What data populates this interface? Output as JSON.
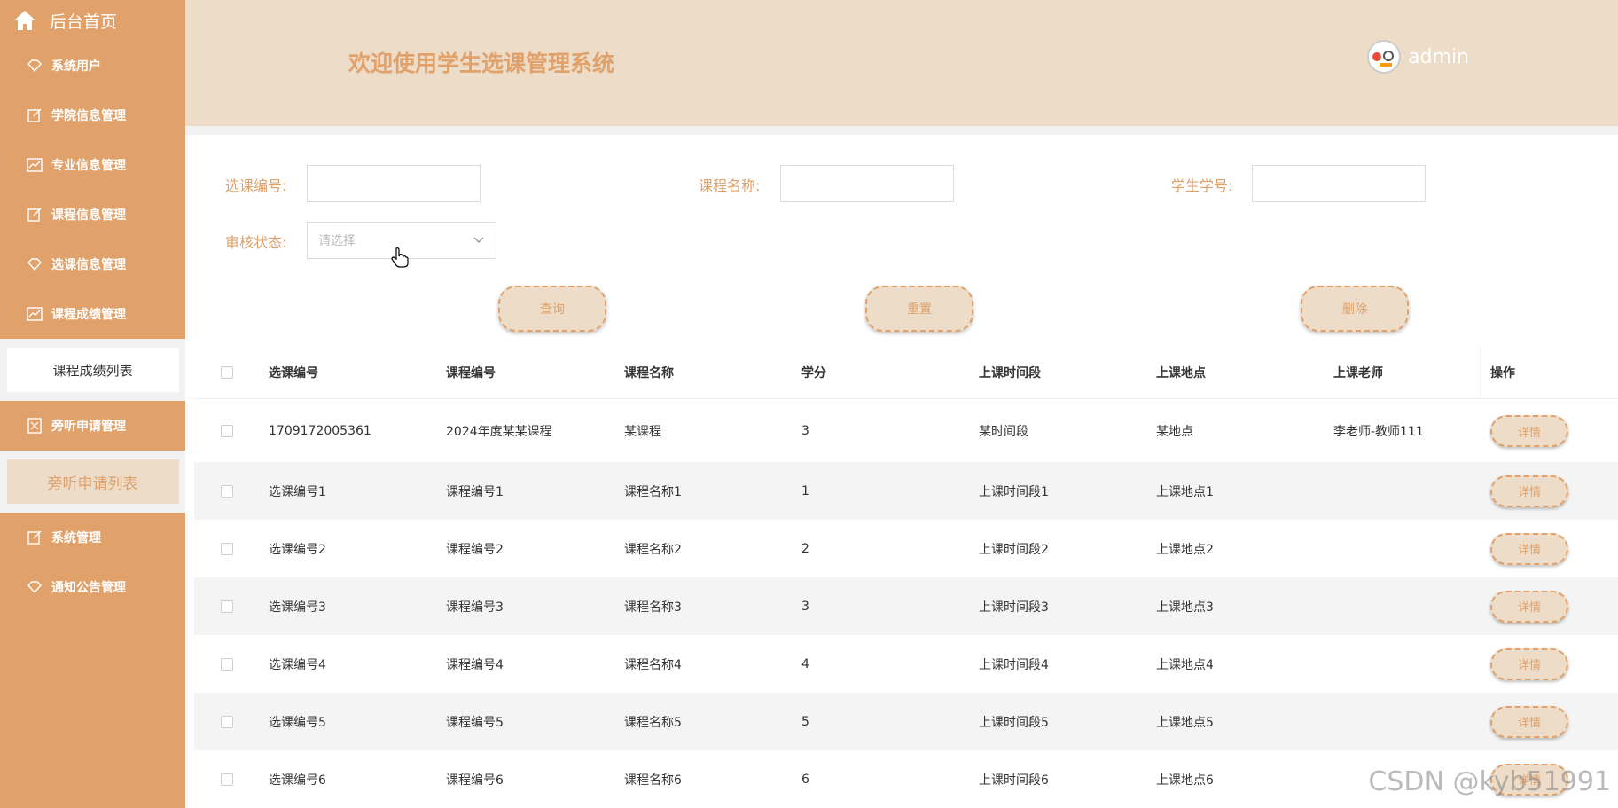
{
  "sidebar": {
    "home_label": "后台首页",
    "items": [
      {
        "label": "系统用户"
      },
      {
        "label": "学院信息管理"
      },
      {
        "label": "专业信息管理"
      },
      {
        "label": "课程信息管理"
      },
      {
        "label": "选课信息管理"
      },
      {
        "label": "课程成绩管理"
      }
    ],
    "sub1": "课程成绩列表",
    "item_audit": "旁听申请管理",
    "sub2": "旁听申请列表",
    "item_sys": "系统管理",
    "item_notice": "通知公告管理"
  },
  "header": {
    "title": "欢迎使用学生选课管理系统",
    "username": "admin"
  },
  "search": {
    "label_select_no": "选课编号:",
    "label_course_name": "课程名称:",
    "label_student_no": "学生学号:",
    "label_audit_status": "审核状态:",
    "audit_placeholder": "请选择",
    "btn_query": "查询",
    "btn_reset": "重置",
    "btn_delete": "删除"
  },
  "table": {
    "columns": [
      "选课编号",
      "课程编号",
      "课程名称",
      "学分",
      "上课时间段",
      "上课地点",
      "上课老师",
      "操作"
    ],
    "rows": [
      [
        "1709172005361",
        "2024年度某某课程",
        "某课程",
        "3",
        "某时间段",
        "某地点",
        "李老师-教师111"
      ],
      [
        "选课编号1",
        "课程编号1",
        "课程名称1",
        "1",
        "上课时间段1",
        "上课地点1",
        ""
      ],
      [
        "选课编号2",
        "课程编号2",
        "课程名称2",
        "2",
        "上课时间段2",
        "上课地点2",
        ""
      ],
      [
        "选课编号3",
        "课程编号3",
        "课程名称3",
        "3",
        "上课时间段3",
        "上课地点3",
        ""
      ],
      [
        "选课编号4",
        "课程编号4",
        "课程名称4",
        "4",
        "上课时间段4",
        "上课地点4",
        ""
      ],
      [
        "选课编号5",
        "课程编号5",
        "课程名称5",
        "5",
        "上课时间段5",
        "上课地点5",
        ""
      ],
      [
        "选课编号6",
        "课程编号6",
        "课程名称6",
        "6",
        "上课时间段6",
        "上课地点6",
        ""
      ]
    ],
    "detail_label": "详情"
  },
  "watermark": "CSDN @kyb51991",
  "colors": {
    "accent": "#e0a16a",
    "header_bg": "#ecdcc8"
  }
}
